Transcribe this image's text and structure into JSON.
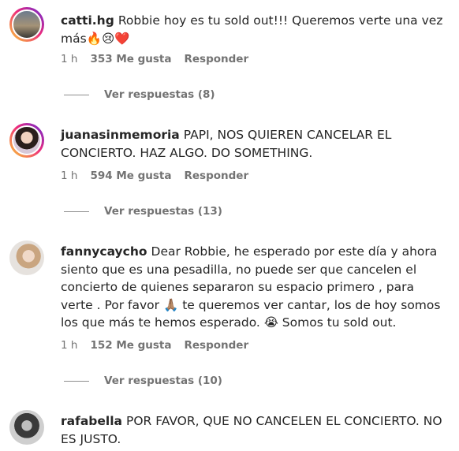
{
  "comments": [
    {
      "username": "catti.hg",
      "text": "Robbie hoy es tu sold out!!! Queremos verte una vez más🔥😢❤️",
      "time": "1 h",
      "likes": "353 Me gusta",
      "reply": "Responder",
      "view_replies": "Ver respuestas (8)"
    },
    {
      "username": "juanasinmemoria",
      "text": "PAPI, NOS QUIEREN CANCELAR EL CONCIERTO. HAZ ALGO. DO SOMETHING.",
      "time": "1 h",
      "likes": "594 Me gusta",
      "reply": "Responder",
      "view_replies": "Ver respuestas (13)"
    },
    {
      "username": "fannycaycho",
      "text": "Dear Robbie, he esperado por este día y ahora siento que es una pesadilla, no puede ser que cancelen el concierto de quienes separaron su espacio primero , para verte . Por favor 🙏🏽 te queremos ver cantar, los de hoy somos los que más te hemos esperado. 😭 Somos tu sold out.",
      "time": "1 h",
      "likes": "152 Me gusta",
      "reply": "Responder",
      "view_replies": "Ver respuestas (10)"
    },
    {
      "username": "rafabella",
      "text": "POR FAVOR, QUE NO CANCELEN EL CONCIERTO. NO ES JUSTO."
    }
  ]
}
